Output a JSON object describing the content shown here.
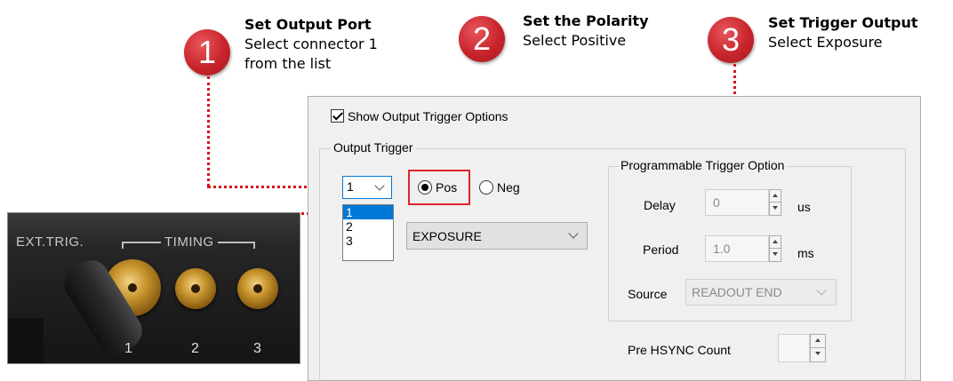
{
  "steps": [
    {
      "number": "1",
      "title": "Set Output Port",
      "desc_line1": "Select connector 1",
      "desc_line2": "from the list"
    },
    {
      "number": "2",
      "title": "Set the Polarity",
      "desc_line1": "Select Positive"
    },
    {
      "number": "3",
      "title": "Set Trigger Output",
      "desc_line1": "Select Exposure"
    }
  ],
  "photo": {
    "ext_trig_label": "EXT.TRIG.",
    "timing_label": "TIMING",
    "connector_numbers": [
      "1",
      "2",
      "3"
    ]
  },
  "dialog": {
    "show_options_label": "Show Output Trigger Options",
    "show_options_checked": true,
    "output_trigger": {
      "group_title": "Output Trigger",
      "port_value": "1",
      "port_options": [
        "1",
        "2",
        "3"
      ],
      "selected_option": "1",
      "polarity_pos_label": "Pos",
      "polarity_neg_label": "Neg",
      "polarity_selected": "Pos",
      "kind_value": "EXPOSURE"
    },
    "programmable": {
      "group_title": "Programmable Trigger Option",
      "delay_label": "Delay",
      "delay_value": "0",
      "delay_unit": "us",
      "period_label": "Period",
      "period_value": "1.0",
      "period_unit": "ms",
      "source_label": "Source",
      "source_value": "READOUT END"
    },
    "pre_hsync_label": "Pre HSYNC Count",
    "pre_hsync_value": ""
  },
  "colors": {
    "callout_red": "#c8242b",
    "dotted_line": "#d8141b",
    "selection_blue": "#0078d7"
  }
}
